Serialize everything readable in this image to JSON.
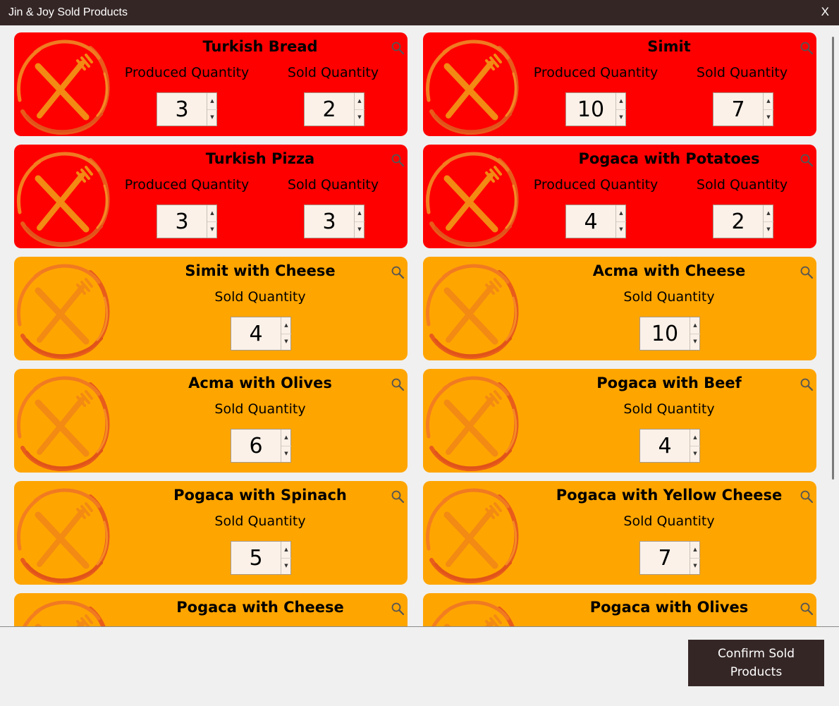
{
  "window": {
    "title": "Jin & Joy Sold Products",
    "close_label": "X"
  },
  "colors": {
    "titlebar": "#352626",
    "red_card": "#ff0000",
    "orange_card": "#ffa500",
    "button": "#352626"
  },
  "labels": {
    "produced": "Produced Quantity",
    "sold": "Sold Quantity"
  },
  "products": [
    {
      "name": "Turkish Bread",
      "variant": "red",
      "produced": "3",
      "sold": "2",
      "icon": "fork-knife-plate-icon"
    },
    {
      "name": "Simit",
      "variant": "red",
      "produced": "10",
      "sold": "7",
      "icon": "fork-knife-plate-icon"
    },
    {
      "name": "Turkish Pizza",
      "variant": "red",
      "produced": "3",
      "sold": "3",
      "icon": "fork-knife-plate-icon"
    },
    {
      "name": "Pogaca with Potatoes",
      "variant": "red",
      "produced": "4",
      "sold": "2",
      "icon": "fork-knife-plate-icon"
    },
    {
      "name": "Simit with Cheese",
      "variant": "orange",
      "sold": "4",
      "icon": "fork-knife-plate-icon"
    },
    {
      "name": "Acma with Cheese",
      "variant": "orange",
      "sold": "10",
      "icon": "fork-knife-plate-icon"
    },
    {
      "name": "Acma with Olives",
      "variant": "orange",
      "sold": "6",
      "icon": "fork-knife-plate-icon"
    },
    {
      "name": "Pogaca with Beef",
      "variant": "orange",
      "sold": "4",
      "icon": "fork-knife-plate-icon"
    },
    {
      "name": "Pogaca with Spinach",
      "variant": "orange",
      "sold": "5",
      "icon": "fork-knife-plate-icon"
    },
    {
      "name": "Pogaca with Yellow Cheese",
      "variant": "orange",
      "sold": "7",
      "icon": "fork-knife-plate-icon"
    },
    {
      "name": "Pogaca with Cheese",
      "variant": "orange",
      "icon": "fork-knife-plate-icon"
    },
    {
      "name": "Pogaca with Olives",
      "variant": "orange",
      "icon": "fork-knife-plate-icon"
    }
  ],
  "footer": {
    "confirm_label": "Confirm Sold Products"
  }
}
